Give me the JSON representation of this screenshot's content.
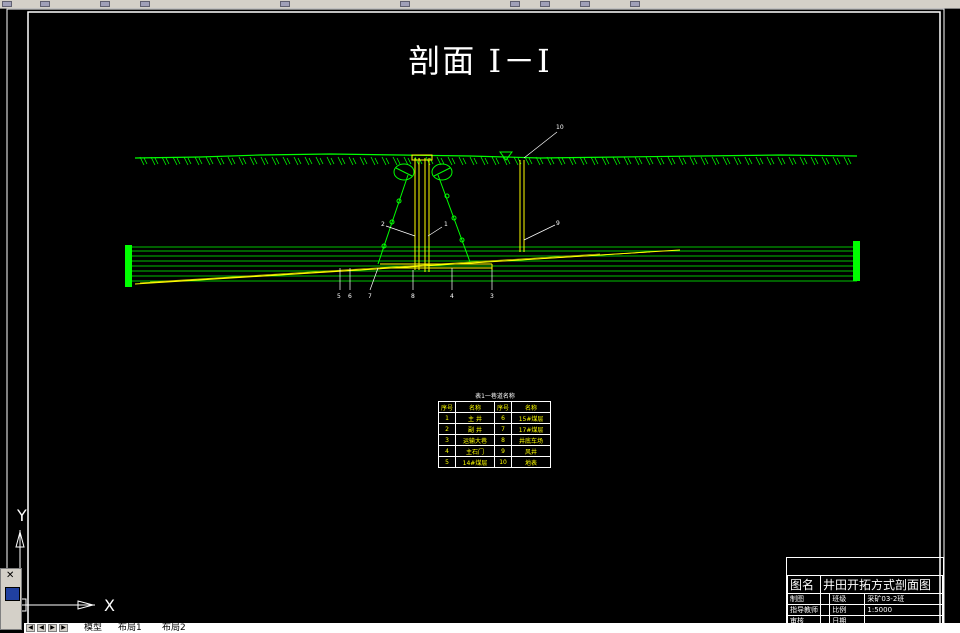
{
  "title": "剖面 Ⅰ－Ⅰ",
  "labels": {
    "top": [
      "10"
    ],
    "upper": [
      "2",
      "1",
      "9"
    ],
    "bottom": [
      "5",
      "6",
      "7",
      "8",
      "4",
      "3"
    ]
  },
  "legend": {
    "caption": "表1一巷道名称",
    "headers": [
      "序号",
      "名称",
      "序号",
      "名称"
    ],
    "rows": [
      [
        "1",
        "主 井",
        "6",
        "15#煤层"
      ],
      [
        "2",
        "副 井",
        "7",
        "17#煤层"
      ],
      [
        "3",
        "运输大巷",
        "8",
        "井底车场"
      ],
      [
        "4",
        "主石门",
        "9",
        "风井"
      ],
      [
        "5",
        "14#煤层",
        "10",
        "地表"
      ]
    ]
  },
  "title_block": {
    "drawing_label": "图名",
    "drawing_name": "井田开拓方式剖面图",
    "rows": [
      [
        "制图",
        "",
        "班级",
        "采矿03-2班"
      ],
      [
        "指导教师",
        "",
        "比例",
        "1:5000"
      ],
      [
        "审核",
        "",
        "日期",
        ""
      ]
    ]
  },
  "ucs": {
    "x": "X",
    "y": "Y"
  },
  "layout_tabs": [
    "模型",
    "布局1",
    "布局2"
  ],
  "colors": {
    "ground": "#00ff00",
    "seam": "#ffff00",
    "line": "#ffffff"
  }
}
